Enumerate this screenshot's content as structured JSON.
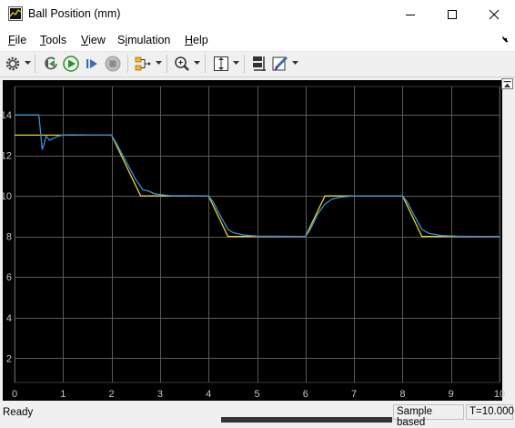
{
  "window": {
    "title": "Ball Position (mm)"
  },
  "menu": {
    "items": [
      "File",
      "Tools",
      "View",
      "Simulation",
      "Help"
    ],
    "mnemonics": [
      "F",
      "T",
      "V",
      "i",
      "H"
    ]
  },
  "toolbar": {
    "icons": [
      "settings-gear-icon",
      "step-back-icon",
      "run-icon",
      "step-forward-icon",
      "stop-icon",
      "signal-selector-icon",
      "zoom-icon",
      "scale-axes-icon",
      "cursor-measure-icon",
      "highlight-icon"
    ]
  },
  "status": {
    "ready": "Ready",
    "sample_mode": "Sample based",
    "time": "T=10.000"
  },
  "colors": {
    "plot_bg": "#000000",
    "grid": "#5a5a5a",
    "axis_text": "#c8c8c8",
    "reference_series": "#e6d52a",
    "measured_series": "#3d8fd8"
  },
  "chart_data": {
    "type": "line",
    "title": "",
    "xlabel": "",
    "ylabel": "",
    "xlim": [
      0,
      10
    ],
    "ylim": [
      0.8,
      15.4
    ],
    "xticks": [
      0,
      1,
      2,
      3,
      4,
      5,
      6,
      7,
      8,
      9,
      10
    ],
    "yticks": [
      2,
      4,
      6,
      8,
      10,
      12,
      14
    ],
    "grid": true,
    "legend": "none",
    "series": [
      {
        "color": "#e6d52a",
        "x": [
          0,
          2,
          2.6,
          4,
          4.4,
          6,
          6.4,
          8,
          8.4,
          10
        ],
        "y": [
          13,
          13,
          10,
          10,
          8,
          8,
          10,
          10,
          8,
          8
        ]
      },
      {
        "color": "#3d8fd8",
        "x": [
          0,
          0.5,
          0.53,
          0.57,
          0.6,
          0.65,
          0.72,
          0.8,
          0.9,
          1.0,
          1.2,
          1.5,
          2.0,
          2.1,
          2.3,
          2.5,
          2.65,
          2.75,
          2.9,
          3.2,
          4.0,
          4.1,
          4.25,
          4.4,
          4.5,
          4.7,
          5.0,
          6.0,
          6.1,
          6.25,
          6.4,
          6.55,
          6.75,
          7.0,
          8.0,
          8.1,
          8.25,
          8.4,
          8.55,
          8.8,
          9.2,
          10
        ],
        "y": [
          14,
          14,
          13.3,
          12.3,
          12.5,
          12.95,
          12.75,
          12.85,
          12.95,
          13,
          13.02,
          13,
          13,
          12.6,
          11.7,
          10.8,
          10.3,
          10.25,
          10.1,
          10.02,
          10,
          9.7,
          9.0,
          8.35,
          8.2,
          8.08,
          8.02,
          8,
          8.35,
          9.1,
          9.6,
          9.85,
          9.95,
          10,
          10,
          9.7,
          9.0,
          8.35,
          8.15,
          8.05,
          8.01,
          8
        ]
      }
    ]
  }
}
